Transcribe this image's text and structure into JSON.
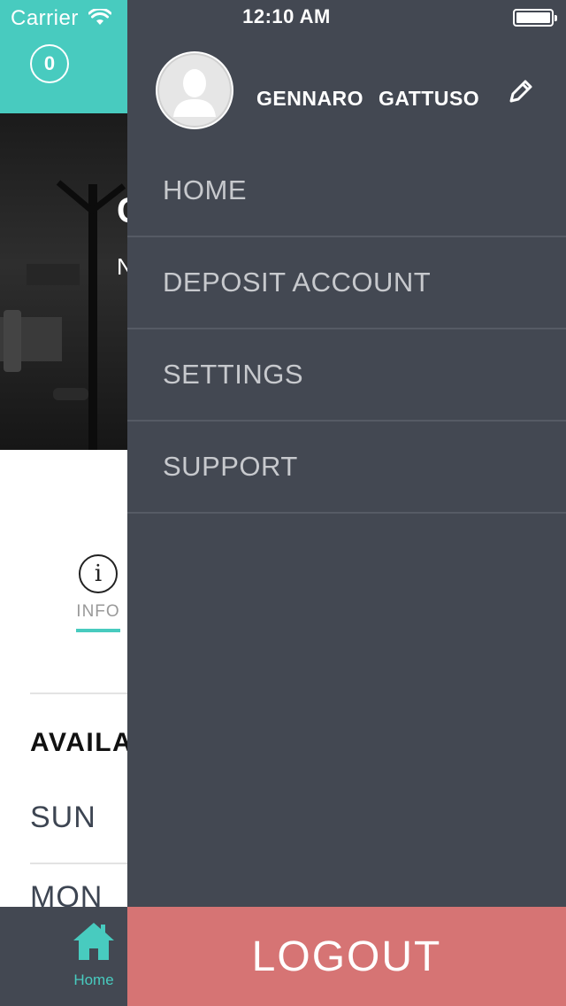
{
  "status_bar": {
    "carrier": "Carrier",
    "time": "12:10 AM"
  },
  "underlying_page": {
    "balance_badge": "0",
    "hero_title_clip": "C",
    "hero_subtitle_clip": "N",
    "info_tab_label": "INFO",
    "availability_label": "AVAILA",
    "days": [
      "SUN",
      "MON"
    ],
    "accent_color": "#48cbbf"
  },
  "drawer": {
    "user_name": "GENNARO GATTUSO",
    "menu_items": [
      "HOME",
      "DEPOSIT ACCOUNT",
      "SETTINGS",
      "SUPPORT"
    ],
    "background_color": "#434852"
  },
  "bottom_tab": {
    "home_label": "Home"
  },
  "logout": {
    "label": "LOGOUT",
    "color": "#d67474"
  },
  "icons": [
    "wifi-icon",
    "battery-icon",
    "avatar-placeholder-icon",
    "pencil-icon",
    "info-icon",
    "home-icon"
  ]
}
